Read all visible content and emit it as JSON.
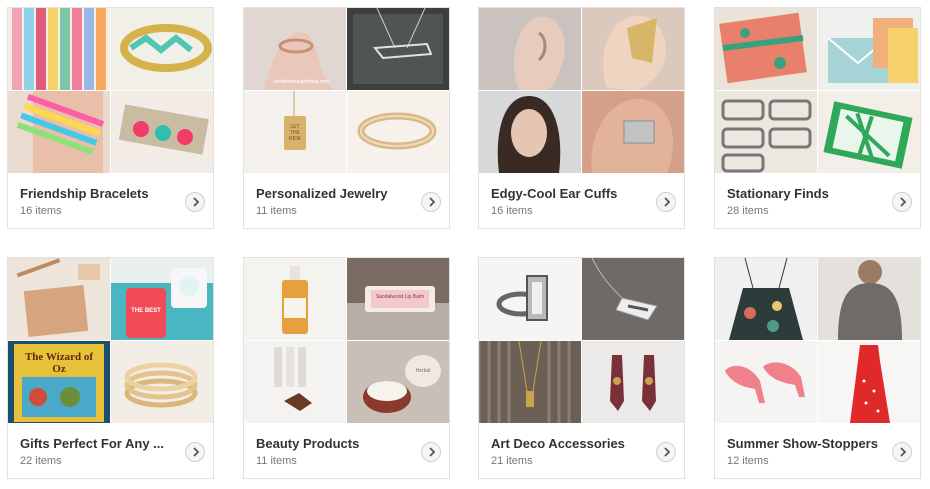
{
  "collections": [
    {
      "title": "Friendship Bracelets",
      "count": "16 items"
    },
    {
      "title": "Personalized Jewelry",
      "count": "11 items"
    },
    {
      "title": "Edgy-Cool Ear Cuffs",
      "count": "16 items"
    },
    {
      "title": "Stationary Finds",
      "count": "28 items"
    },
    {
      "title": "Gifts Perfect For Any ...",
      "count": "22 items"
    },
    {
      "title": "Beauty Products",
      "count": "11 items"
    },
    {
      "title": "Art Deco Accessories",
      "count": "21 items"
    },
    {
      "title": "Summer Show-Stoppers",
      "count": "12 items"
    }
  ],
  "image_text": {
    "wizard_book": "The Wizard of Oz",
    "jewelry_watermark": "theafterthoughtshop.com",
    "pendant_text": "LET THE RIDE",
    "mug_text": "THE BEST",
    "balm_label": "Sandalwood Lip Balm",
    "tin_label": "Herbal"
  },
  "icons": {
    "arrow": "chevron-right-icon"
  }
}
